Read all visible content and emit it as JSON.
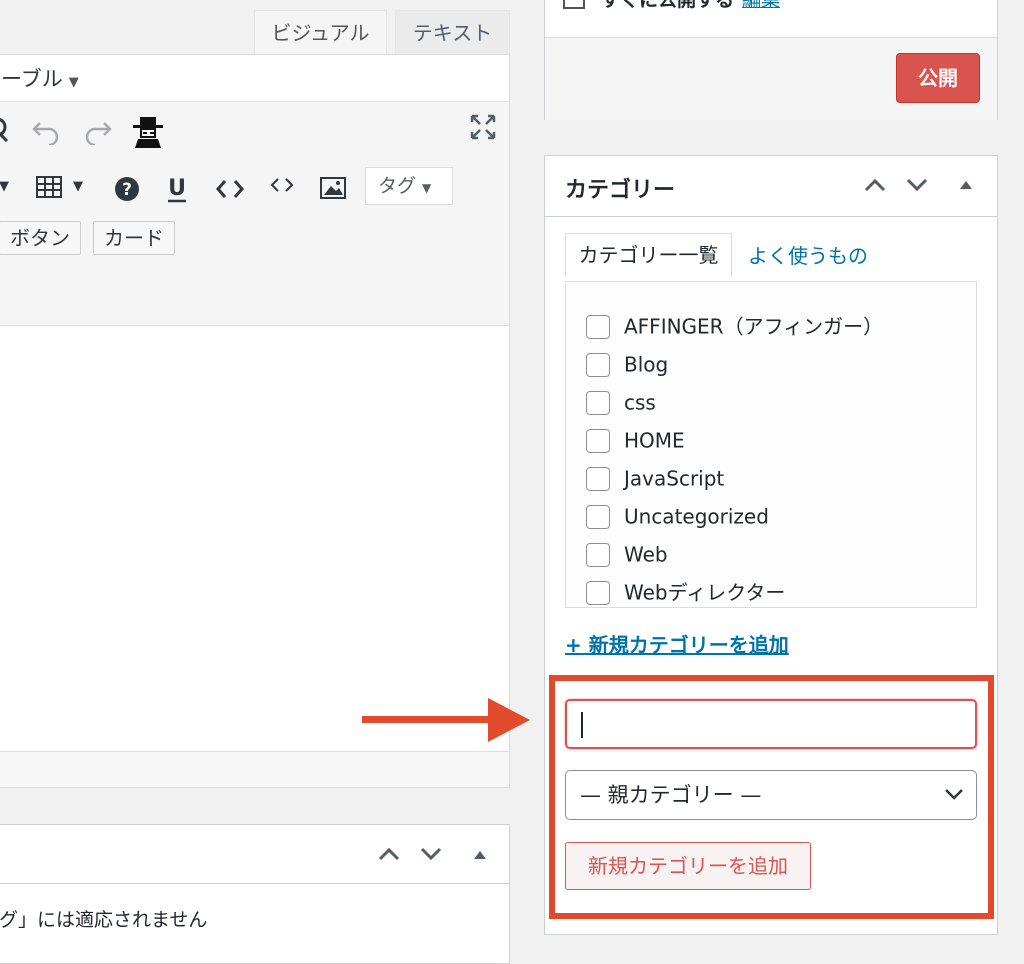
{
  "editor": {
    "tabs": {
      "visual": "ビジュアル",
      "text": "テキスト"
    },
    "format_select": "ーブル",
    "toolbar_icons": [
      "q-icon",
      "undo-icon",
      "redo-icon",
      "person-hat-icon",
      "fullscreen-icon"
    ],
    "row2_icons": [
      "caret-icon",
      "table-icon",
      "help-icon",
      "underline-icon",
      "code-tag-icon",
      "code-icon",
      "image-icon"
    ],
    "tag_select": "タグ",
    "buttons": {
      "button": "ボタン",
      "card": "カード"
    }
  },
  "box2": {
    "text": "グ」には適応されません"
  },
  "publish": {
    "immediately": "すぐに公開する",
    "edit": "編集",
    "publish_button": "公開"
  },
  "category": {
    "title": "カテゴリー",
    "tabs": {
      "all": "カテゴリー一覧",
      "popular": "よく使うもの"
    },
    "items": [
      "AFFINGER（アフィンガー）",
      "Blog",
      "css",
      "HOME",
      "JavaScript",
      "Uncategorized",
      "Web",
      "Webディレクター"
    ],
    "add_new_link": "+ 新規カテゴリーを追加",
    "new_name_value": "",
    "parent_select": "— 親カテゴリー —",
    "add_button": "新規カテゴリーを追加"
  },
  "colors": {
    "highlight": "#e24a2e",
    "publish": "#d9534f",
    "link": "#0073aa"
  }
}
